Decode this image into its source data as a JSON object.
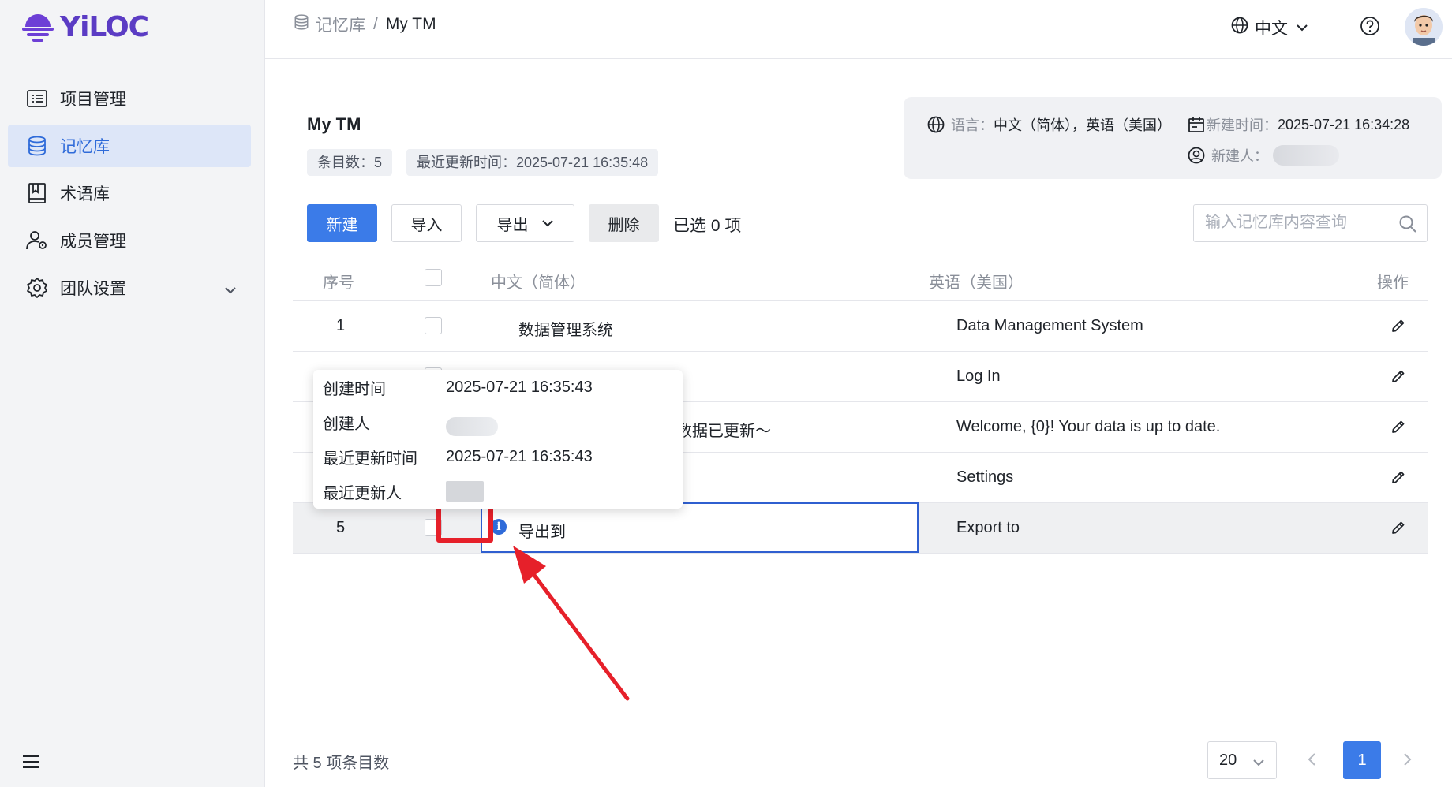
{
  "app": {
    "logo_text": "YiLOC",
    "brand_color": "#5b3cc4",
    "accent_color": "#3b7be8"
  },
  "sidebar": {
    "items": [
      {
        "label": "项目管理",
        "icon": "list-icon"
      },
      {
        "label": "记忆库",
        "icon": "database-icon",
        "active": true
      },
      {
        "label": "术语库",
        "icon": "book-icon"
      },
      {
        "label": "成员管理",
        "icon": "user-gear-icon"
      },
      {
        "label": "团队设置",
        "icon": "gear-icon",
        "expandable": true
      }
    ]
  },
  "header": {
    "breadcrumb_root": "记忆库",
    "breadcrumb_sep": "/",
    "breadcrumb_current": "My TM",
    "language": "中文"
  },
  "tm": {
    "title": "My TM",
    "entry_count_label": "条目数：5",
    "last_updated_label": "最近更新时间：2025-07-21 16:35:48",
    "languages_label": "语言：",
    "languages_value": "中文（简体），英语（美国）",
    "created_label": "新建时间：",
    "created_value": "2025-07-21 16:34:28",
    "creator_label": "新建人："
  },
  "toolbar": {
    "new_label": "新建",
    "import_label": "导入",
    "export_label": "导出",
    "delete_label": "删除",
    "selected_label": "已选 0 项",
    "search_placeholder": "输入记忆库内容查询"
  },
  "table": {
    "headers": {
      "index": "序号",
      "source": "中文（简体）",
      "target": "英语（美国）",
      "actions": "操作"
    },
    "rows": [
      {
        "index": "1",
        "source": "数据管理系统",
        "target": "Data Management System"
      },
      {
        "index": "",
        "source": "",
        "target": "Log In"
      },
      {
        "index": "",
        "source": "数据已更新～",
        "target": "Welcome, {0}! Your data is up to date."
      },
      {
        "index": "",
        "source": "",
        "target": "Settings"
      },
      {
        "index": "5",
        "source": "导出到",
        "target": "Export to"
      }
    ]
  },
  "popover": {
    "created_time_label": "创建时间",
    "created_time_value": "2025-07-21 16:35:43",
    "creator_label": "创建人",
    "updated_time_label": "最近更新时间",
    "updated_time_value": "2025-07-21 16:35:43",
    "updater_label": "最近更新人"
  },
  "footer": {
    "total_label": "共 5 项条目数",
    "page_size": "20",
    "current_page": "1"
  }
}
